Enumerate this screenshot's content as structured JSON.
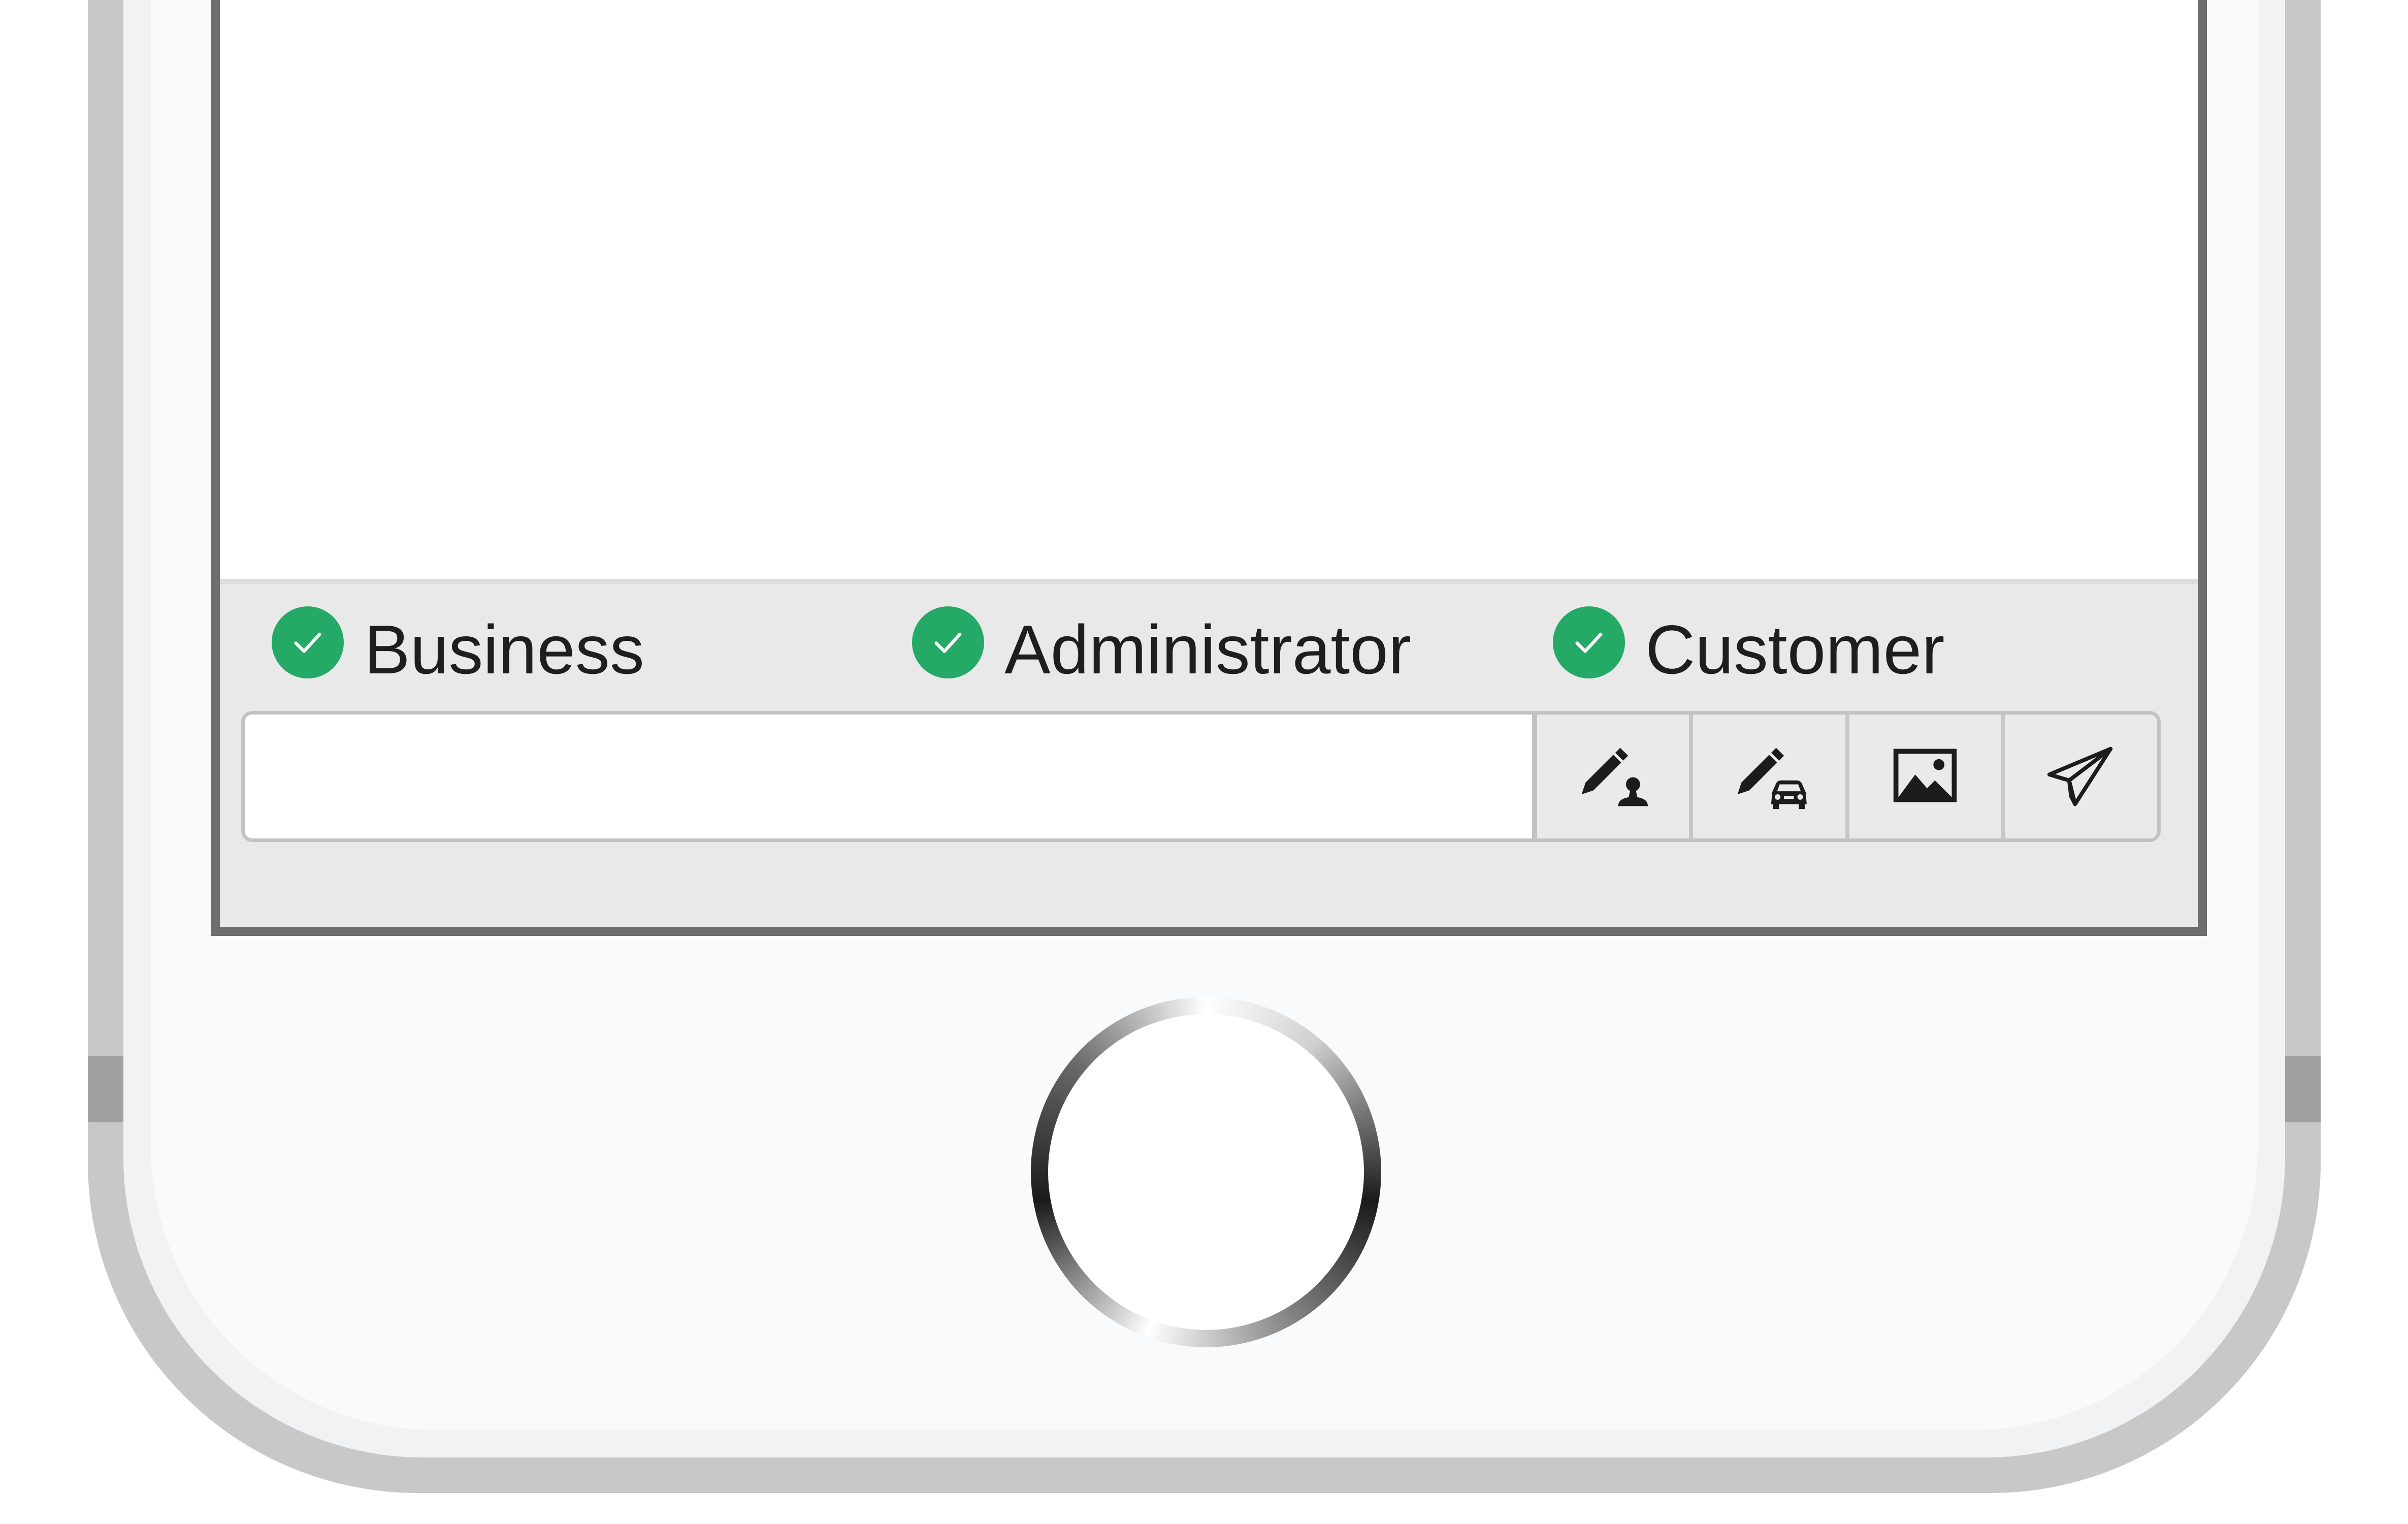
{
  "recipients": [
    {
      "label": "Business",
      "selected": true,
      "icon": "check-circle-icon"
    },
    {
      "label": "Administrator",
      "selected": true,
      "icon": "check-circle-icon"
    },
    {
      "label": "Customer",
      "selected": true,
      "icon": "check-circle-icon"
    }
  ],
  "composer": {
    "message_value": "",
    "message_placeholder": "",
    "buttons": [
      {
        "name": "edit-contact-button",
        "icon": "pencil-person-icon"
      },
      {
        "name": "edit-vehicle-button",
        "icon": "pencil-car-icon"
      },
      {
        "name": "attach-image-button",
        "icon": "image-icon"
      },
      {
        "name": "send-button",
        "icon": "paper-plane-icon"
      }
    ]
  },
  "colors": {
    "check_green": "#25a966",
    "panel_bg": "#e9e9e9",
    "phone_frame": "#c8c8c9"
  }
}
